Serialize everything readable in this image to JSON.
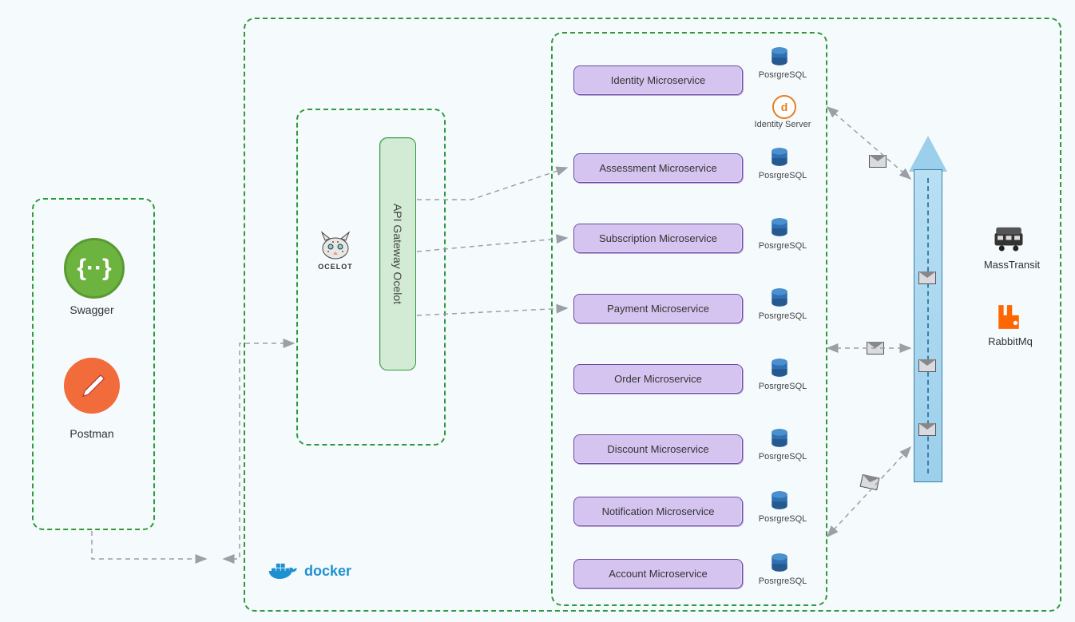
{
  "clients": {
    "swagger_label": "Swagger",
    "postman_label": "Postman"
  },
  "gateway": {
    "label": "API Gateway Ocelot",
    "ocelot_label": "OCELOT"
  },
  "docker_label": "docker",
  "microservices": [
    {
      "label": "Identity Microservice",
      "db_label": "PosrgreSQL"
    },
    {
      "label": "Assessment Microservice",
      "db_label": "PosrgreSQL"
    },
    {
      "label": "Subscription Microservice",
      "db_label": "PosrgreSQL"
    },
    {
      "label": "Payment Microservice",
      "db_label": "PosrgreSQL"
    },
    {
      "label": "Order Microservice",
      "db_label": "PosrgreSQL"
    },
    {
      "label": "Discount Microservice",
      "db_label": "PosrgreSQL"
    },
    {
      "label": "Notification Microservice",
      "db_label": "PosrgreSQL"
    },
    {
      "label": "Account Microservice",
      "db_label": "PosrgreSQL"
    }
  ],
  "identity_server_label": "Identity Server",
  "messaging": {
    "masstransit_label": "MassTransit",
    "rabbitmq_label": "RabbitMq"
  },
  "colors": {
    "dash_green": "#2e9a3a",
    "ms_purple": "#d6c4f0",
    "ms_border": "#6a4ea0",
    "db_blue": "#2f6fb3",
    "arrow_gray": "#9aa0a6"
  }
}
